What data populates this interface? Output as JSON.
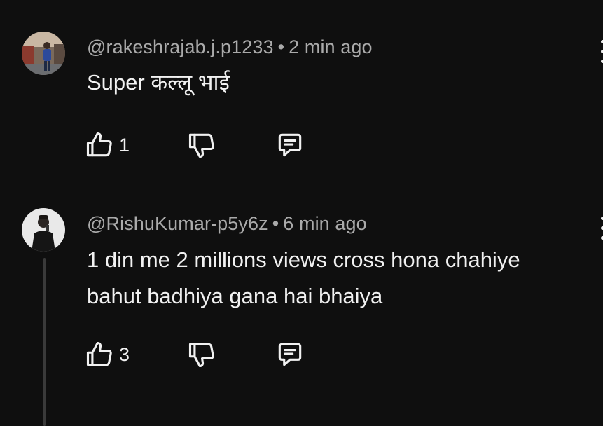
{
  "comments": [
    {
      "author": "@rakeshrajab.j.p1233",
      "separator": "•",
      "time": "2 min ago",
      "text_lines": [
        "Super कल्लू भाई"
      ],
      "like_count": "1",
      "avatar_icon": "user-avatar-photo-man-blue-shirt"
    },
    {
      "author": "@RishuKumar-p5y6z",
      "separator": "•",
      "time": "6 min ago",
      "text_lines": [
        "1 din me 2 millions views cross hona chahiye",
        "bahut badhiya gana hai bhaiya"
      ],
      "like_count": "3",
      "avatar_icon": "user-avatar-photo-man-black-shirt"
    }
  ],
  "icons": {
    "like": "thumbs-up-icon",
    "dislike": "thumbs-down-icon",
    "reply": "reply-comment-icon",
    "more": "more-vertical-icon"
  },
  "colors": {
    "background": "#0f0f0f",
    "primary_text": "#f1f1f1",
    "secondary_text": "#aaaaaa",
    "thread_line": "#3a3a3a"
  }
}
